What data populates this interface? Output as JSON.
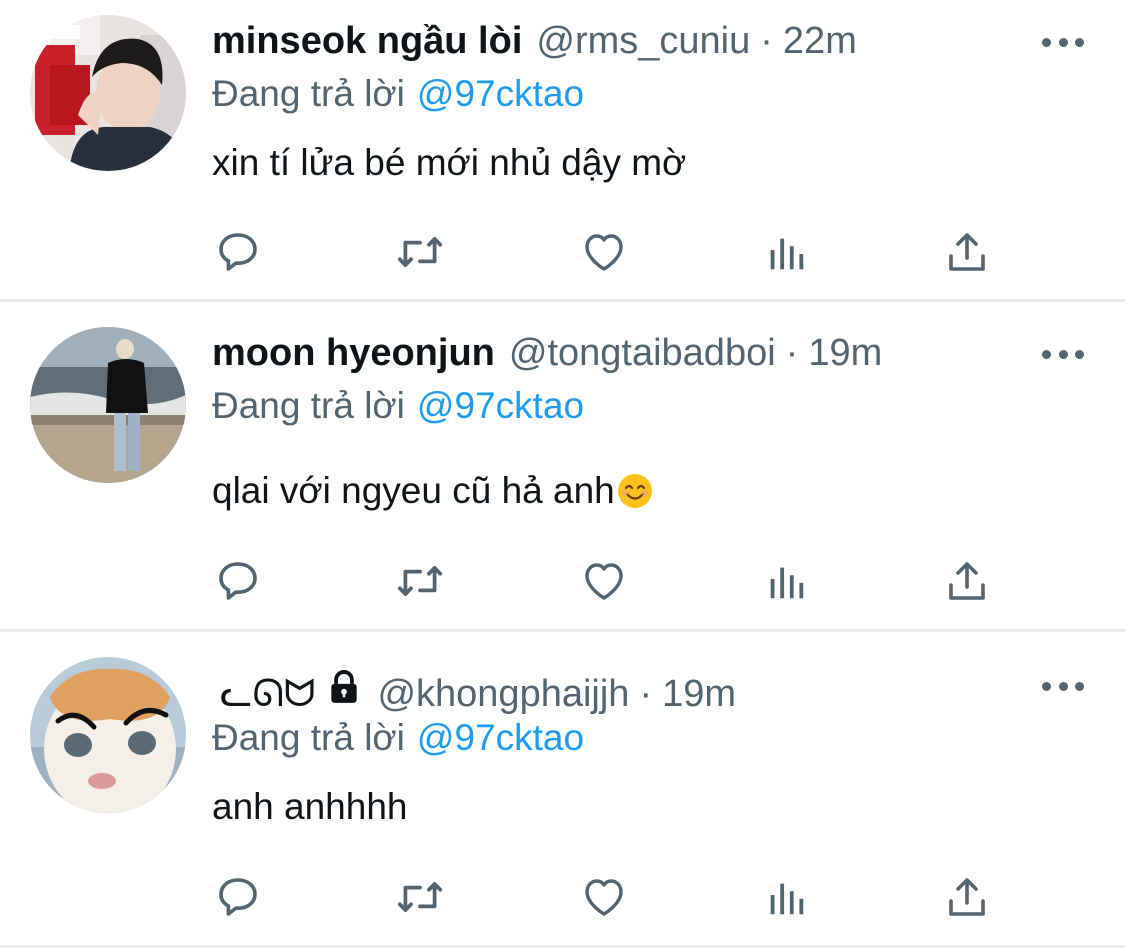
{
  "reply_prefix": "Đang trả lời",
  "tweets": [
    {
      "name": "minseok ngầu lòi",
      "handle": "@rms_cuniu",
      "time": "22m",
      "reply_to": "@97cktao",
      "text": "xin tí lửa bé mới nhủ dậy mờ"
    },
    {
      "name": "moon hyeonjun",
      "handle": "@tongtaibadboi",
      "time": "19m",
      "reply_to": "@97cktao",
      "text": "qlai với ngyeu cũ hả anh"
    },
    {
      "name": "ᓚᘏᗢ",
      "handle": "@khongphaijjh",
      "time": "19m",
      "reply_to": "@97cktao",
      "text": "anh anhhhh"
    }
  ],
  "separator": "·",
  "icons": {
    "reply": "speech-bubble-icon",
    "retweet": "retweet-arrows-icon",
    "like": "heart-outline-icon",
    "stats": "bar-chart-icon",
    "share": "share-upload-icon",
    "more": "more-dots-icon",
    "protected": "lock-icon",
    "emoji": "smiling-face-emoji"
  },
  "colors": {
    "text": "#0f1419",
    "secondary": "#536471",
    "link": "#1d9bf0",
    "divider": "#e6ecf0"
  }
}
